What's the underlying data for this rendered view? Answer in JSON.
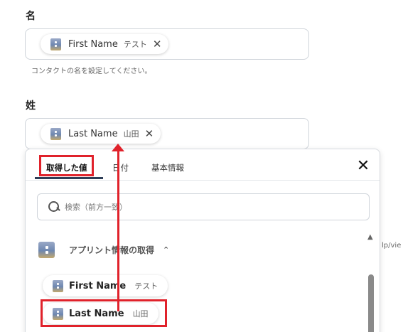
{
  "first_name_field": {
    "label": "名",
    "chip_name": "First Name",
    "chip_value": "テスト",
    "hint": "コンタクトの名を設定してください。"
  },
  "last_name_field": {
    "label": "姓",
    "chip_name": "Last Name",
    "chip_value": "山田"
  },
  "dropdown": {
    "tabs": [
      "取得した値",
      "日付",
      "基本情報"
    ],
    "active_tab": "取得した値",
    "search_placeholder": "検索（前方一致）",
    "section_title": "アプリント情報の取得",
    "options": [
      {
        "name": "First Name",
        "value": "テスト"
      },
      {
        "name": "Last Name",
        "value": "山田"
      }
    ]
  },
  "background_fragment": "lp/vie",
  "colors": {
    "highlight": "#e0222b",
    "tab_underline": "#2e3e57"
  }
}
